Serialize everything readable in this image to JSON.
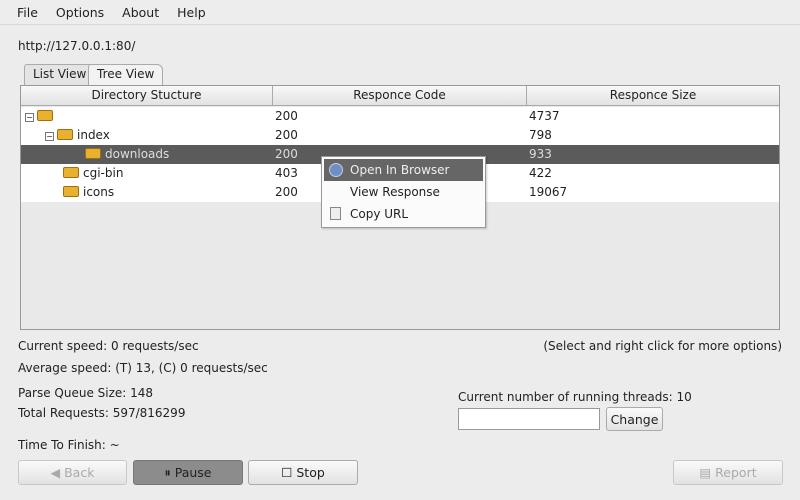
{
  "menu": [
    "File",
    "Options",
    "About",
    "Help"
  ],
  "url": "http://127.0.0.1:80/",
  "tabs": [
    "List View",
    "Tree View"
  ],
  "table": {
    "headers": [
      "Directory Stucture",
      "Responce Code",
      "Responce Size"
    ],
    "rows": [
      {
        "name": "",
        "code": "200",
        "size": "4737"
      },
      {
        "name": "index",
        "code": "200",
        "size": "798"
      },
      {
        "name": "downloads",
        "code": "200",
        "size": "933"
      },
      {
        "name": "cgi-bin",
        "code": "403",
        "size": "422"
      },
      {
        "name": "icons",
        "code": "200",
        "size": "19067"
      }
    ]
  },
  "context_menu": [
    "Open In Browser",
    "View Response",
    "Copy URL"
  ],
  "status": {
    "current_speed": "Current speed: 0 requests/sec",
    "hint": "(Select and right click for more options)",
    "average_speed": "Average speed: (T) 13, (C) 0 requests/sec",
    "parse_queue": "Parse Queue Size: 148",
    "total_requests": "Total Requests: 597/816299",
    "time_to_finish": "Time To Finish: ~",
    "threads": "Current number of running threads: 10"
  },
  "thread_input": "",
  "buttons": {
    "change": "Change",
    "back": "Back",
    "pause": "Pause",
    "stop": "Stop",
    "report": "Report"
  }
}
